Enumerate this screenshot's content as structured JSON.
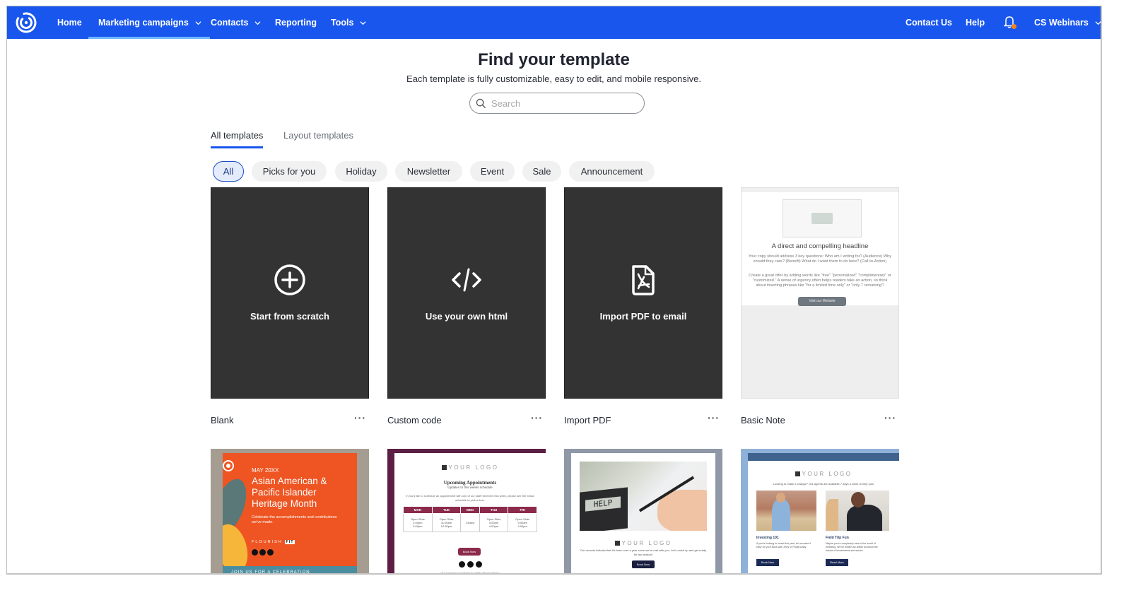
{
  "nav": {
    "logo": "constant-contact-logo",
    "items": [
      {
        "label": "Home",
        "has_dropdown": false,
        "active": false
      },
      {
        "label": "Marketing campaigns",
        "has_dropdown": true,
        "active": true
      },
      {
        "label": "Contacts",
        "has_dropdown": true,
        "active": false
      },
      {
        "label": "Reporting",
        "has_dropdown": false,
        "active": false
      },
      {
        "label": "Tools",
        "has_dropdown": true,
        "active": false
      }
    ],
    "right": {
      "contact_us": "Contact Us",
      "help": "Help",
      "notification_icon": "bell-icon",
      "notification_dot_color": "#f7821b",
      "account": "CS Webinars"
    },
    "bg_color": "#1856ed"
  },
  "header": {
    "title": "Find your template",
    "subtitle": "Each template is fully customizable, easy to edit, and mobile responsive.",
    "search_placeholder": "Search",
    "search_value": ""
  },
  "tabs": [
    {
      "label": "All templates",
      "active": true
    },
    {
      "label": "Layout templates",
      "active": false
    }
  ],
  "filters": [
    {
      "label": "All",
      "selected": true
    },
    {
      "label": "Picks for you",
      "selected": false
    },
    {
      "label": "Holiday",
      "selected": false
    },
    {
      "label": "Newsletter",
      "selected": false
    },
    {
      "label": "Event",
      "selected": false
    },
    {
      "label": "Sale",
      "selected": false
    },
    {
      "label": "Announcement",
      "selected": false
    }
  ],
  "templates": [
    {
      "name": "Blank",
      "action": "Start from scratch",
      "icon": "plus-circle-icon",
      "more": "···"
    },
    {
      "name": "Custom code",
      "action": "Use your own html",
      "icon": "code-icon",
      "more": "···"
    },
    {
      "name": "Import PDF",
      "action": "Import PDF to email",
      "icon": "pdf-file-icon",
      "more": "···"
    },
    {
      "name": "Basic Note",
      "more": "···",
      "preview": {
        "headline": "A direct and compelling headline",
        "para1": "Your copy should address 3 key questions: Who am I writing for? (Audience) Why should they care? (Benefit) What do I want them to do here? (Call-to-Action)",
        "para2": "Create a great offer by adding words like \"free\" \"personalized\" \"complimentary\" or \"customized.\" A sense of urgency often helps readers take an action, so think about inserting phrases like \"for a limited time only\" or \"only 7 remaining\"!",
        "button": "Visit our Website"
      }
    }
  ],
  "thumbnails": [
    {
      "kind": "aapi",
      "date": "MAY 20XX",
      "headline": "Asian American & Pacific Islander Heritage Month",
      "sub": "Celebrate the accomplishments and contributions we've made.",
      "brand": "FLOURISH",
      "brand_tag": "FIT",
      "band": "JOIN US FOR A CELEBRATION"
    },
    {
      "kind": "appointments",
      "logo": "YOUR LOGO",
      "title": "Upcoming Appointments",
      "subtitle": "Updates to this weeks schedule",
      "desc": "If you'd like to schedule an appointment with one of our staff members this week, please see the below schedule to pick a time.",
      "days": [
        "MON",
        "TUE",
        "WED",
        "THU",
        "FRI"
      ],
      "slots": [
        [
          "Open Slots",
          "2:00pm",
          "3:00pm"
        ],
        [
          "Open Slots",
          "11:00am",
          "12:30pm"
        ],
        [
          "Closed"
        ],
        [
          "Open Slots",
          "3:00pm",
          "4:00pm"
        ],
        [
          "Open Slots",
          "9:00am",
          "4:00pm"
        ]
      ],
      "button": "Book Now",
      "footer": "Our Company | Contact Us | Web | Privacy Policy"
    },
    {
      "kind": "tax",
      "screen_text": "HELP",
      "logo": "YOUR LOGO",
      "desc": "Our records indicate that it's been over a year since we've met with you. Let's catch up and get ready for tax season!",
      "button": "Book Now"
    },
    {
      "kind": "real-estate",
      "logo": "YOUR LOGO",
      "desc": "Looking to make a change? Our agents are available 7 days a week to help you!",
      "col1_title": "Investing 101",
      "col1_text": "If you're looking to invest this year, let us make it easy for you! Book with Jerry or Paula today.",
      "col1_button": "Book Now",
      "col2_title": "Field Trip Fun",
      "col2_text": "Maybe you're completely new to the world of investing. We've written an article all about the basics of investments and stocks.",
      "col2_button": "Read More"
    }
  ]
}
